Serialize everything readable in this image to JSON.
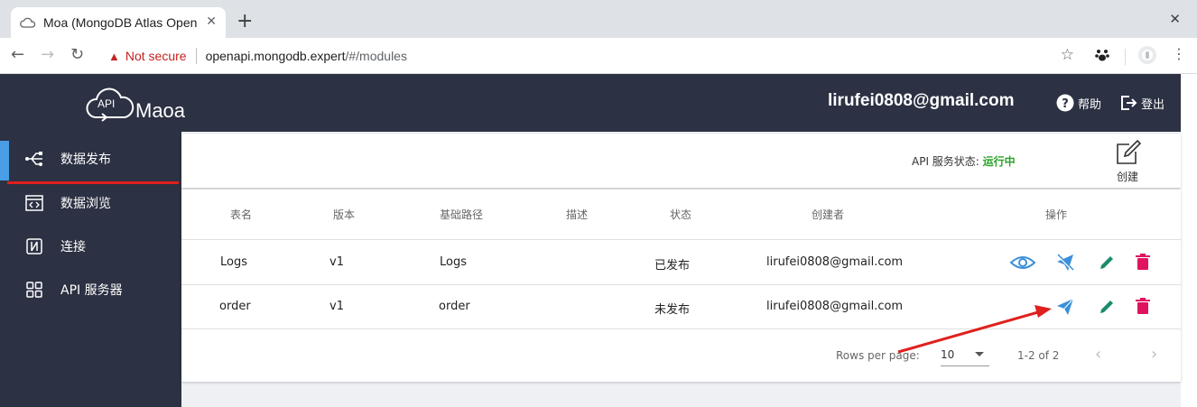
{
  "browser": {
    "tab_title": "Moa (MongoDB Atlas Open",
    "tab_close": "✕",
    "new_tab": "+",
    "window_close": "✕",
    "not_secure": "Not secure",
    "url_host": "openapi.mongodb.expert",
    "url_path": "/#/modules"
  },
  "header": {
    "logo_badge": "API",
    "logo_text": "Maoa",
    "user_email": "lirufei0808@gmail.com",
    "help_label": "帮助",
    "logout_label": "登出"
  },
  "sidebar": {
    "items": [
      {
        "label": "数据发布",
        "icon": "usb-publish-icon",
        "active": true
      },
      {
        "label": "数据浏览",
        "icon": "code-window-icon",
        "active": false
      },
      {
        "label": "连接",
        "icon": "connection-icon",
        "active": false
      },
      {
        "label": "API 服务器",
        "icon": "grid-icon",
        "active": false
      }
    ]
  },
  "status_panel": {
    "label": "API 服务状态:",
    "value": "运行中",
    "create_label": "创建"
  },
  "table": {
    "columns": [
      "表名",
      "版本",
      "基础路径",
      "描述",
      "状态",
      "创建者",
      "操作"
    ],
    "rows": [
      {
        "name": "Logs",
        "version": "v1",
        "base_path": "Logs",
        "description": "",
        "status": "已发布",
        "creator": "lirufei0808@gmail.com",
        "actions": [
          "view-icon",
          "unpublish-icon",
          "edit-icon",
          "delete-icon"
        ]
      },
      {
        "name": "order",
        "version": "v1",
        "base_path": "order",
        "description": "",
        "status": "未发布",
        "creator": "lirufei0808@gmail.com",
        "actions": [
          "publish-icon",
          "edit-icon",
          "delete-icon"
        ]
      }
    ]
  },
  "pagination": {
    "rows_per_page_label": "Rows per page:",
    "rows_per_page": "10",
    "range": "1-2 of 2"
  },
  "colors": {
    "header_bg": "#2c3143",
    "active_bar": "#4a9ee6",
    "running": "#29a329",
    "edit": "#1a8c6e",
    "delete": "#e0135f",
    "view": "#3b8fd9",
    "annotation": "#e0201d"
  }
}
